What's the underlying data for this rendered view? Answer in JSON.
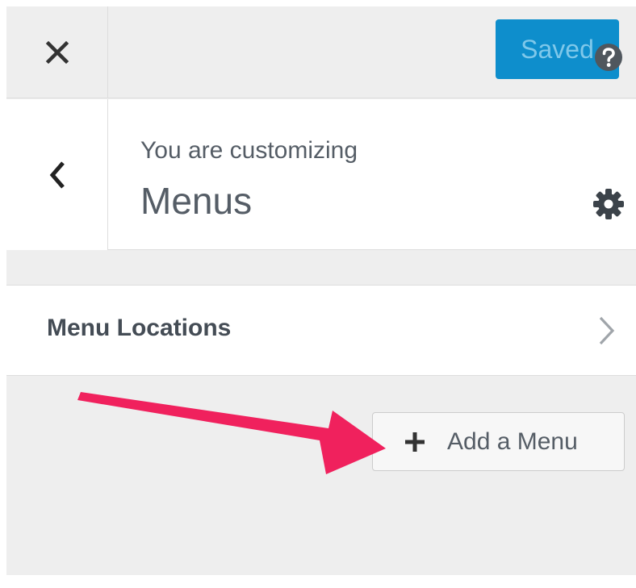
{
  "header": {
    "close_icon": "close-icon",
    "save_label": "Saved"
  },
  "info": {
    "back_icon": "chevron-left-icon",
    "customizing_label": "You are customizing",
    "section_title": "Menus",
    "help_icon": "help-icon",
    "settings_icon": "gear-icon"
  },
  "menu_locations": {
    "label": "Menu Locations",
    "chevron_icon": "chevron-right-icon"
  },
  "add_menu": {
    "label": "Add a Menu",
    "plus_icon": "plus-icon"
  },
  "annotation": {
    "arrow_color": "#f0215d"
  },
  "colors": {
    "panel_bg": "#eeeeee",
    "section_bg": "#ffffff",
    "save_button_bg": "#0e8ecc",
    "save_button_text": "#7fc8ea",
    "text": "#555d66"
  }
}
